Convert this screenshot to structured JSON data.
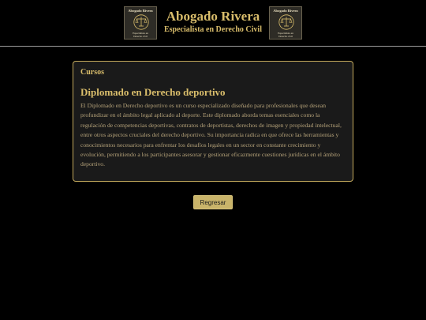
{
  "header": {
    "title": "Abogado Rivera",
    "subtitle": "Especialista en Derecho Civil",
    "logo": {
      "top_text": "Abogado Rivera",
      "bottom_line1": "Especialista en",
      "bottom_line2": "Derecho civil",
      "icon": "scales-of-justice-icon"
    }
  },
  "card": {
    "header": "Cursos",
    "course_title": "Diplomado en Derecho deportivo",
    "description": "El Diplomado en Derecho deportivo es un curso especializado diseñado para profesionales que desean profundizar en el ámbito legal aplicado al deporte. Este diplomado aborda temas esenciales como la regulación de competencias deportivas, contratos de deportistas, derechos de imagen y propiedad intelectual, entre otros aspectos cruciales del derecho deportivo. Su importancia radica en que ofrece las herramientas y conocimientos necesarios para enfrentar los desafíos legales en un sector en constante crecimiento y evolución, permitiendo a los participantes asesorar y gestionar eficazmente cuestiones jurídicas en el ámbito deportivo."
  },
  "actions": {
    "back_label": "Regresar"
  },
  "colors": {
    "background": "#000000",
    "accent_gold": "#d9bd6b",
    "card_background": "#1a1a1a",
    "card_border": "#c3a95c",
    "button_background": "#c9b46a"
  }
}
